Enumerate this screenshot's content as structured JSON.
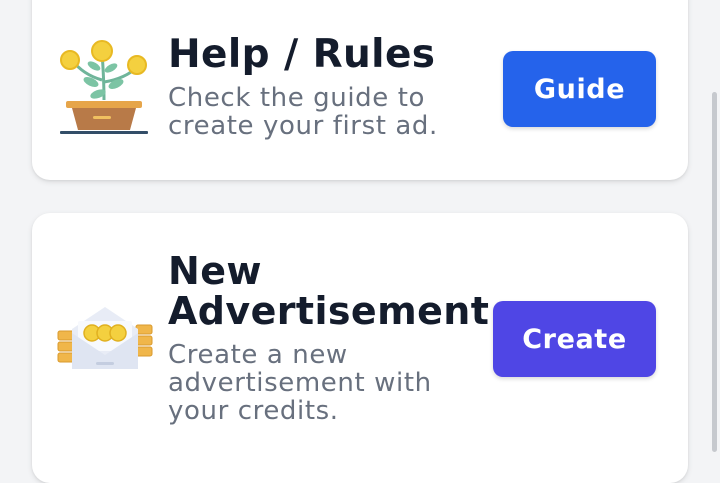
{
  "help_card": {
    "title": "Help / Rules",
    "description": "Check the guide to create your first ad.",
    "button_label": "Guide",
    "icon": "flower-pot-coins-icon"
  },
  "new_ad_card": {
    "title": "New Advertisement",
    "description": "Create a new advertisement with your credits.",
    "button_label": "Create",
    "icon": "envelope-coins-icon"
  },
  "colors": {
    "guide_button": "#2563eb",
    "create_button": "#4f46e5",
    "title_text": "#141c2c",
    "description_text": "#68707e",
    "background": "#f3f4f6"
  }
}
